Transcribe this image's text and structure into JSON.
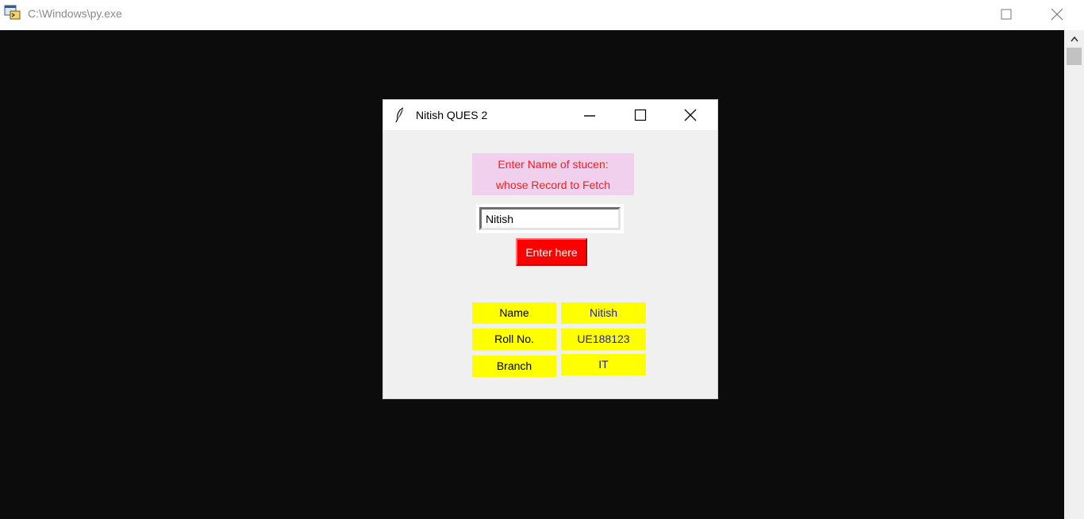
{
  "console": {
    "title": "C:\\Windows\\py.exe",
    "icons": {
      "app": "python-console-icon",
      "maximize": "maximize-icon",
      "close": "close-icon",
      "scroll_up": "chevron-up-icon"
    }
  },
  "tk_window": {
    "title": "Nitish QUES 2",
    "icons": {
      "app": "feather-icon",
      "minimize": "minimize-icon",
      "maximize": "maximize-icon",
      "close": "close-icon"
    },
    "prompt_line1": "Enter Name of stucen:",
    "prompt_line2": "whose Record to Fetch",
    "entry_value": "Nitish",
    "button_label": "Enter here",
    "record": [
      {
        "label": "Name",
        "value": "Nitish"
      },
      {
        "label": "Roll No.",
        "value": "UE188123"
      },
      {
        "label": "Branch",
        "value": "IT"
      }
    ],
    "colors": {
      "prompt_bg": "#f1d0ee",
      "prompt_text": "#ff1a1a",
      "button_bg": "#ff0000",
      "cell_bg": "#ffff00",
      "value_text": "#2222aa"
    }
  }
}
